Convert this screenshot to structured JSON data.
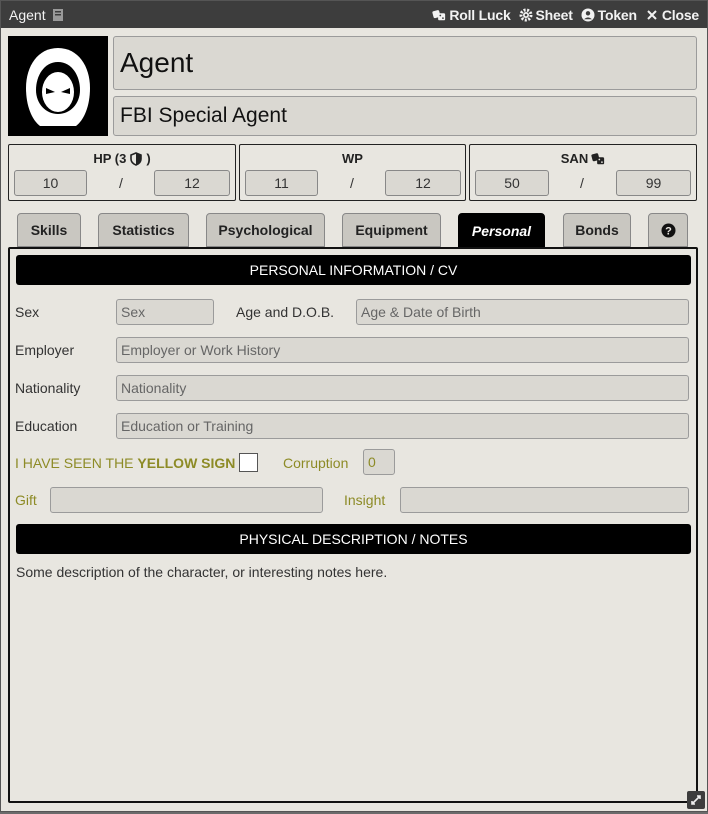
{
  "window": {
    "title": "Agent",
    "title_icon": "book-icon",
    "actions": [
      {
        "label": "Roll Luck",
        "icon": "dice-icon"
      },
      {
        "label": "Sheet",
        "icon": "gear-icon"
      },
      {
        "label": "Token",
        "icon": "user-circle-icon"
      },
      {
        "label": "Close",
        "icon": "close-icon"
      }
    ]
  },
  "header": {
    "name": "Agent",
    "occupation": "FBI Special Agent"
  },
  "stats": {
    "hp": {
      "label": "HP (3",
      "current": "10",
      "sep": "/",
      "max": "12"
    },
    "wp": {
      "label": "WP",
      "current": "11",
      "sep": "/",
      "max": "12"
    },
    "san": {
      "label": "SAN",
      "current": "50",
      "sep": "/",
      "max": "99"
    }
  },
  "tabs": [
    {
      "label": "Skills"
    },
    {
      "label": "Statistics"
    },
    {
      "label": "Psychological"
    },
    {
      "label": "Equipment"
    },
    {
      "label": "Personal"
    },
    {
      "label": "Bonds"
    },
    {
      "label": "?"
    }
  ],
  "personal": {
    "section_title": "PERSONAL INFORMATION / CV",
    "sex": {
      "label": "Sex",
      "placeholder": "Sex"
    },
    "age": {
      "label": "Age and D.O.B.",
      "placeholder": "Age & Date of Birth"
    },
    "employer": {
      "label": "Employer",
      "placeholder": "Employer or Work History"
    },
    "nationality": {
      "label": "Nationality",
      "placeholder": "Nationality"
    },
    "education": {
      "label": "Education",
      "placeholder": "Education or Training"
    },
    "yellow_sign": {
      "prefix": "I HAVE SEEN THE",
      "emph": "YELLOW SIGN"
    },
    "corruption": {
      "label": "Corruption",
      "value": "0"
    },
    "gift": {
      "label": "Gift",
      "value": ""
    },
    "insight": {
      "label": "Insight",
      "value": ""
    }
  },
  "physical": {
    "section_title": "PHYSICAL DESCRIPTION / NOTES",
    "text": "Some description of the character, or interesting notes here."
  },
  "colors": {
    "titlebar": "#3d3d3d",
    "accent_yellow": "#8d8b26",
    "header_black": "#000000"
  }
}
